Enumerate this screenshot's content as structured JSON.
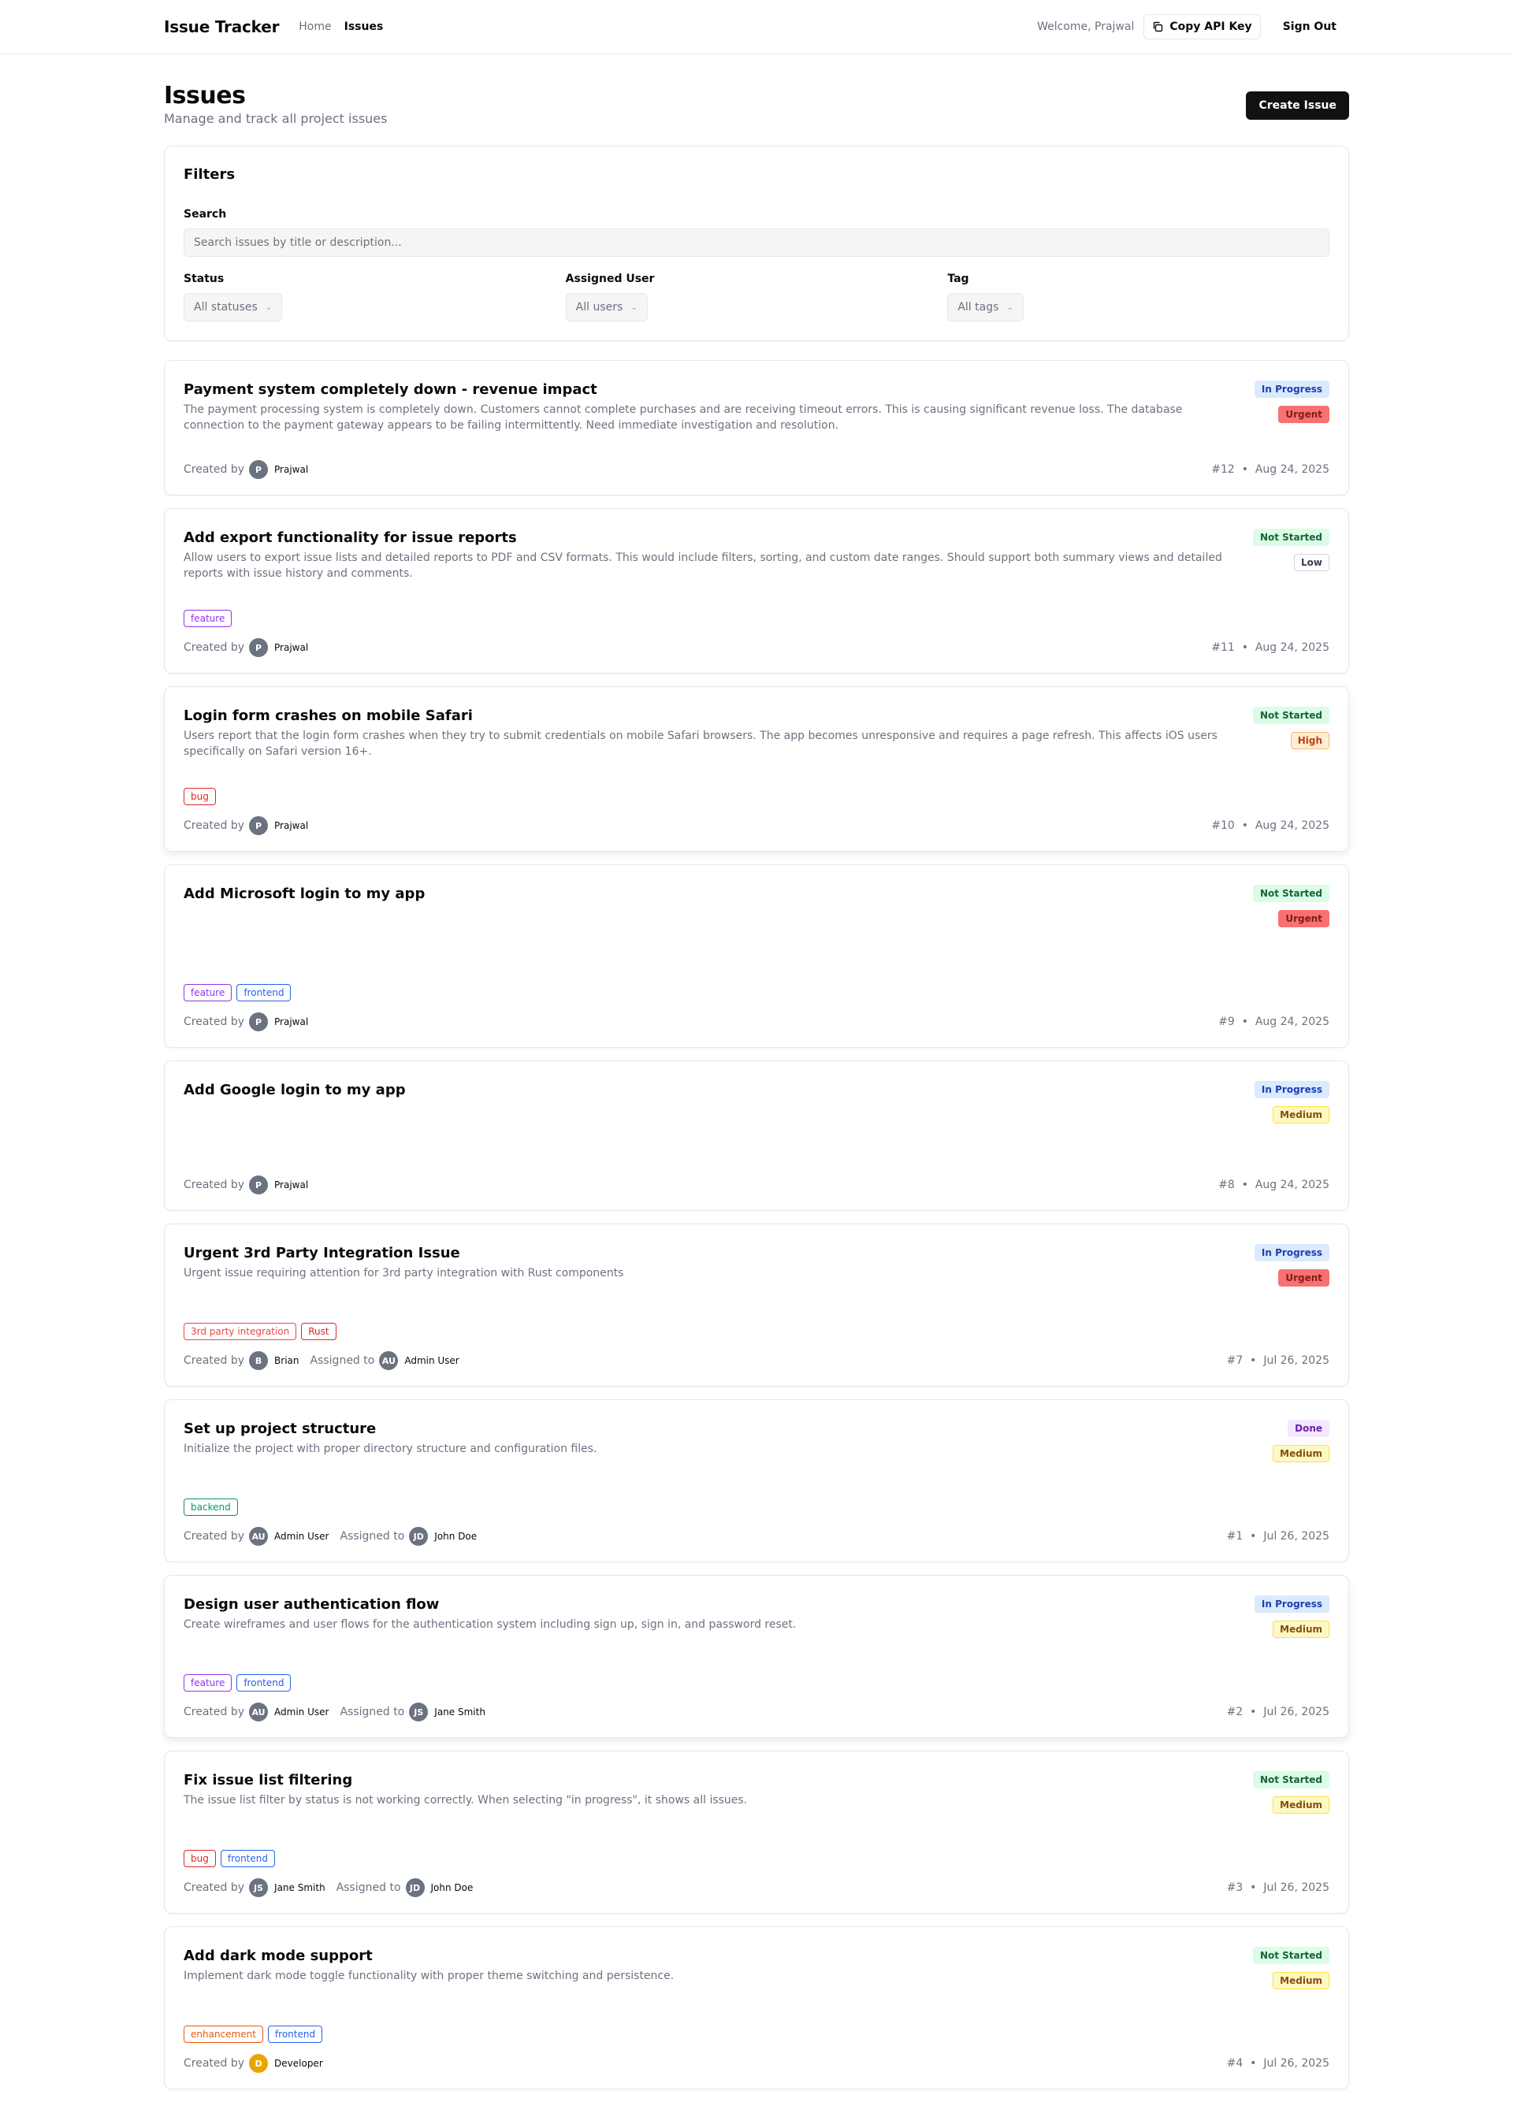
{
  "nav": {
    "brand": "Issue Tracker",
    "links": [
      "Home",
      "Issues"
    ],
    "welcome": "Welcome, Prajwal",
    "copy_api_key": "Copy API Key",
    "sign_out": "Sign Out"
  },
  "header": {
    "title": "Issues",
    "subtitle": "Manage and track all project issues",
    "create_button": "Create Issue"
  },
  "filters": {
    "title": "Filters",
    "search_label": "Search",
    "search_placeholder": "Search issues by title or description...",
    "status_label": "Status",
    "status_value": "All statuses",
    "user_label": "Assigned User",
    "user_value": "All users",
    "tag_label": "Tag",
    "tag_value": "All tags"
  },
  "labels": {
    "created_by": "Created by",
    "assigned_to": "Assigned to"
  },
  "colors": {
    "status": {
      "In Progress": {
        "bg": "#dbeafe",
        "fg": "#1e40af"
      },
      "Not Started": {
        "bg": "#dcfce7",
        "fg": "#166534"
      },
      "Done": {
        "bg": "#f3e8ff",
        "fg": "#6b21a8"
      }
    },
    "priority": {
      "Urgent": {
        "bg": "#f87171",
        "fg": "#7f1d1d",
        "border": "#f87171"
      },
      "High": {
        "bg": "#ffedd5",
        "fg": "#c2410c",
        "border": "#fdba74"
      },
      "Medium": {
        "bg": "#fef9c3",
        "fg": "#854d0e",
        "border": "#fde047"
      },
      "Low": {
        "bg": "#ffffff",
        "fg": "#374151",
        "border": "#d1d5db"
      }
    },
    "tags": {
      "feature": "#9333ea",
      "frontend": "#2563eb",
      "bug": "#dc2626",
      "3rd party integration": "#ef4444",
      "Rust": "#dc2626",
      "backend": "#059669",
      "enhancement": "#ea580c"
    }
  },
  "issues": [
    {
      "title": "Payment system completely down - revenue impact",
      "description": "The payment processing system is completely down. Customers cannot complete purchases and are receiving timeout errors. This is causing significant revenue loss. The database connection to the payment gateway appears to be failing intermittently. Need immediate investigation and resolution.",
      "status": "In Progress",
      "priority": "Urgent",
      "tags": [],
      "creator": {
        "initials": "P",
        "name": "Prajwal"
      },
      "assignee": null,
      "id": "#12",
      "date": "Aug 24, 2025"
    },
    {
      "title": "Add export functionality for issue reports",
      "description": "Allow users to export issue lists and detailed reports to PDF and CSV formats. This would include filters, sorting, and custom date ranges. Should support both summary views and detailed reports with issue history and comments.",
      "status": "Not Started",
      "priority": "Low",
      "tags": [
        "feature"
      ],
      "creator": {
        "initials": "P",
        "name": "Prajwal"
      },
      "assignee": null,
      "id": "#11",
      "date": "Aug 24, 2025"
    },
    {
      "title": "Login form crashes on mobile Safari",
      "description": "Users report that the login form crashes when they try to submit credentials on mobile Safari browsers. The app becomes unresponsive and requires a page refresh. This affects iOS users specifically on Safari version 16+.",
      "status": "Not Started",
      "priority": "High",
      "tags": [
        "bug"
      ],
      "creator": {
        "initials": "P",
        "name": "Prajwal"
      },
      "assignee": null,
      "id": "#10",
      "date": "Aug 24, 2025",
      "elevated": true
    },
    {
      "title": "Add Microsoft login to my app",
      "description": "",
      "status": "Not Started",
      "priority": "Urgent",
      "tags": [
        "feature",
        "frontend"
      ],
      "creator": {
        "initials": "P",
        "name": "Prajwal"
      },
      "assignee": null,
      "id": "#9",
      "date": "Aug 24, 2025"
    },
    {
      "title": "Add Google login to my app",
      "description": "",
      "status": "In Progress",
      "priority": "Medium",
      "tags": [],
      "creator": {
        "initials": "P",
        "name": "Prajwal"
      },
      "assignee": null,
      "id": "#8",
      "date": "Aug 24, 2025"
    },
    {
      "title": "Urgent 3rd Party Integration Issue",
      "description": "Urgent issue requiring attention for 3rd party integration with Rust components",
      "status": "In Progress",
      "priority": "Urgent",
      "tags": [
        "3rd party integration",
        "Rust"
      ],
      "creator": {
        "initials": "B",
        "name": "Brian"
      },
      "assignee": {
        "initials": "AU",
        "name": "Admin User"
      },
      "id": "#7",
      "date": "Jul 26, 2025"
    },
    {
      "title": "Set up project structure",
      "description": "Initialize the project with proper directory structure and configuration files.",
      "status": "Done",
      "priority": "Medium",
      "tags": [
        "backend"
      ],
      "creator": {
        "initials": "AU",
        "name": "Admin User"
      },
      "assignee": {
        "initials": "JD",
        "name": "John Doe"
      },
      "id": "#1",
      "date": "Jul 26, 2025"
    },
    {
      "title": "Design user authentication flow",
      "description": "Create wireframes and user flows for the authentication system including sign up, sign in, and password reset.",
      "status": "In Progress",
      "priority": "Medium",
      "tags": [
        "feature",
        "frontend"
      ],
      "creator": {
        "initials": "AU",
        "name": "Admin User"
      },
      "assignee": {
        "initials": "JS",
        "name": "Jane Smith"
      },
      "id": "#2",
      "date": "Jul 26, 2025",
      "elevated": true
    },
    {
      "title": "Fix issue list filtering",
      "description": "The issue list filter by status is not working correctly. When selecting \"in progress\", it shows all issues.",
      "status": "Not Started",
      "priority": "Medium",
      "tags": [
        "bug",
        "frontend"
      ],
      "creator": {
        "initials": "JS",
        "name": "Jane Smith"
      },
      "assignee": {
        "initials": "JD",
        "name": "John Doe"
      },
      "id": "#3",
      "date": "Jul 26, 2025"
    },
    {
      "title": "Add dark mode support",
      "description": "Implement dark mode toggle functionality with proper theme switching and persistence.",
      "status": "Not Started",
      "priority": "Medium",
      "tags": [
        "enhancement",
        "frontend"
      ],
      "creator": {
        "initials": "D",
        "name": "Developer",
        "yellow": true
      },
      "assignee": null,
      "id": "#4",
      "date": "Jul 26, 2025"
    }
  ]
}
